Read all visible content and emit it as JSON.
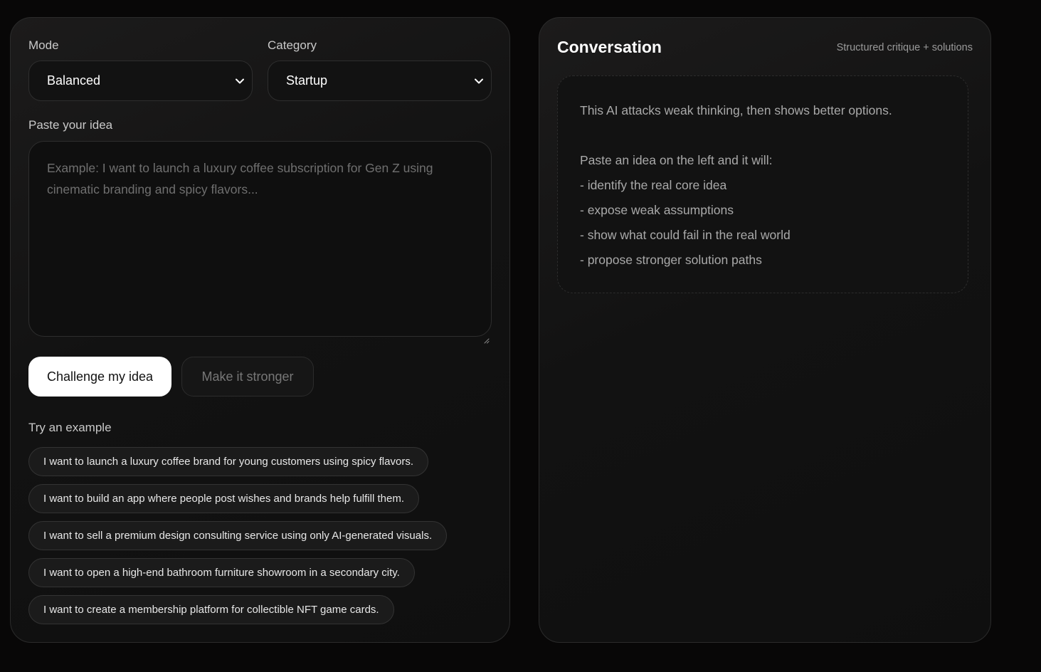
{
  "left_panel": {
    "mode": {
      "label": "Mode",
      "value": "Balanced"
    },
    "category": {
      "label": "Category",
      "value": "Startup"
    },
    "idea_input": {
      "label": "Paste your idea",
      "placeholder": "Example: I want to launch a luxury coffee subscription for Gen Z using cinematic branding and spicy flavors..."
    },
    "buttons": {
      "challenge": "Challenge my idea",
      "stronger": "Make it stronger"
    },
    "examples": {
      "label": "Try an example",
      "items": [
        "I want to launch a luxury coffee brand for young customers using spicy flavors.",
        "I want to build an app where people post wishes and brands help fulfill them.",
        "I want to sell a premium design consulting service using only AI-generated visuals.",
        "I want to open a high-end bathroom furniture showroom in a secondary city.",
        "I want to create a membership platform for collectible NFT game cards."
      ]
    }
  },
  "right_panel": {
    "title": "Conversation",
    "subtitle": "Structured critique + solutions",
    "intro": {
      "headline": "This AI attacks weak thinking, then shows better options.",
      "lead": "Paste an idea on the left and it will:",
      "bullets": [
        "- identify the real core idea",
        "- expose weak assumptions",
        "- show what could fail in the real world",
        "- propose stronger solution paths"
      ]
    }
  },
  "icons": {
    "select_chevron": "chevron-down-icon",
    "textarea_resize": "resize-handle-icon"
  },
  "colors": {
    "background": "#080707",
    "panel": "#141414",
    "primary_button": "#ffffff",
    "muted_text": "#777777"
  }
}
